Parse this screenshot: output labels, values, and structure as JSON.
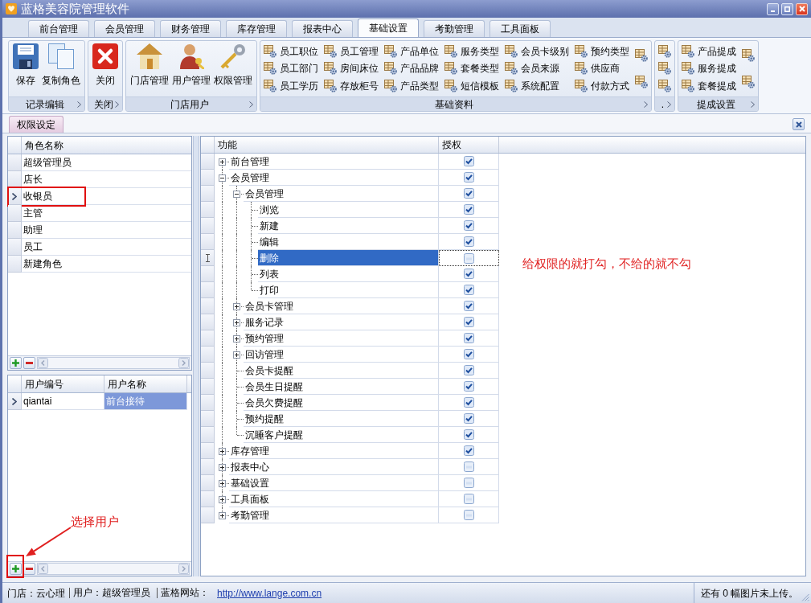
{
  "window": {
    "title": "蓝格美容院管理软件"
  },
  "menu_tabs": [
    {
      "label": "前台管理",
      "selected": false
    },
    {
      "label": "会员管理",
      "selected": false
    },
    {
      "label": "财务管理",
      "selected": false
    },
    {
      "label": "库存管理",
      "selected": false
    },
    {
      "label": "报表中心",
      "selected": false
    },
    {
      "label": "基础设置",
      "selected": true
    },
    {
      "label": "考勤管理",
      "selected": false
    },
    {
      "label": "工具面板",
      "selected": false
    }
  ],
  "ribbon": {
    "groups": [
      {
        "kind": "large",
        "label": "记录编辑",
        "buttons": [
          {
            "label": "保存"
          },
          {
            "label": "复制角色"
          }
        ]
      },
      {
        "kind": "large",
        "label": "关闭",
        "buttons": [
          {
            "label": "关闭"
          }
        ]
      },
      {
        "kind": "large",
        "label": "门店用户",
        "buttons": [
          {
            "label": "门店管理"
          },
          {
            "label": "用户管理"
          },
          {
            "label": "权限管理"
          }
        ]
      },
      {
        "kind": "small",
        "label": "基础资料",
        "columns": [
          [
            {
              "kind": "labeled",
              "label": "员工职位"
            },
            {
              "kind": "labeled",
              "label": "员工部门"
            },
            {
              "kind": "labeled",
              "label": "员工学历"
            }
          ],
          [
            {
              "kind": "labeled",
              "label": "员工管理"
            },
            {
              "kind": "labeled",
              "label": "房间床位"
            },
            {
              "kind": "labeled",
              "label": "存放柜号"
            }
          ],
          [
            {
              "kind": "labeled",
              "label": "产品单位"
            },
            {
              "kind": "labeled",
              "label": "产品品牌"
            },
            {
              "kind": "labeled",
              "label": "产品类型"
            }
          ],
          [
            {
              "kind": "labeled",
              "label": "服务类型"
            },
            {
              "kind": "labeled",
              "label": "套餐类型"
            },
            {
              "kind": "labeled",
              "label": "短信模板"
            }
          ],
          [
            {
              "kind": "labeled",
              "label": "会员卡级别"
            },
            {
              "kind": "labeled",
              "label": "会员来源"
            },
            {
              "kind": "labeled",
              "label": "系统配置"
            }
          ],
          [
            {
              "kind": "labeled",
              "label": "预约类型"
            },
            {
              "kind": "labeled",
              "label": "供应商"
            },
            {
              "kind": "labeled",
              "label": "付款方式"
            }
          ],
          [
            {
              "kind": "icon"
            },
            {
              "kind": "icon"
            }
          ]
        ]
      },
      {
        "kind": "small",
        "label": ".",
        "columns": [
          [
            {
              "kind": "icon"
            },
            {
              "kind": "icon"
            },
            {
              "kind": "icon"
            }
          ]
        ]
      },
      {
        "kind": "small",
        "label": "提成设置",
        "columns": [
          [
            {
              "kind": "labeled",
              "label": "产品提成"
            },
            {
              "kind": "labeled",
              "label": "服务提成"
            },
            {
              "kind": "labeled",
              "label": "套餐提成"
            }
          ],
          [
            {
              "kind": "icon"
            },
            {
              "kind": "icon"
            }
          ]
        ]
      }
    ]
  },
  "document_tab": {
    "label": "权限设定"
  },
  "roles_grid": {
    "columns": [
      "角色名称"
    ],
    "rows": [
      {
        "name": "超级管理员",
        "selected": false,
        "highlighted": false
      },
      {
        "name": "店长",
        "selected": false,
        "highlighted": false
      },
      {
        "name": "收银员",
        "selected": true,
        "highlighted": true
      },
      {
        "name": "主管",
        "selected": false,
        "highlighted": false
      },
      {
        "name": "助理",
        "selected": false,
        "highlighted": false
      },
      {
        "name": "员工",
        "selected": false,
        "highlighted": false
      },
      {
        "name": "新建角色",
        "selected": false,
        "highlighted": false
      }
    ]
  },
  "users_grid": {
    "columns": [
      "用户编号",
      "用户名称"
    ],
    "rows": [
      {
        "cells": [
          "qiantai",
          "前台接待"
        ],
        "selected": true
      }
    ],
    "add_highlighted": true
  },
  "permissions": {
    "columns": [
      "功能",
      "授权"
    ],
    "rows": [
      {
        "label": "前台管理",
        "expanded": false,
        "checked": true,
        "selected": false
      },
      {
        "label": "会员管理",
        "expanded": true,
        "checked": true,
        "selected": false,
        "children": [
          {
            "label": "会员管理",
            "expanded": true,
            "checked": true,
            "selected": false,
            "children": [
              {
                "label": "浏览",
                "checked": true,
                "selected": false
              },
              {
                "label": "新建",
                "checked": true,
                "selected": false
              },
              {
                "label": "编辑",
                "checked": true,
                "selected": false
              },
              {
                "label": "删除",
                "checked": false,
                "selected": true
              },
              {
                "label": "列表",
                "checked": true,
                "selected": false
              },
              {
                "label": "打印",
                "checked": true,
                "selected": false
              }
            ]
          },
          {
            "label": "会员卡管理",
            "expanded": false,
            "checked": true,
            "selected": false
          },
          {
            "label": "服务记录",
            "expanded": false,
            "checked": true,
            "selected": false
          },
          {
            "label": "预约管理",
            "expanded": false,
            "checked": true,
            "selected": false
          },
          {
            "label": "回访管理",
            "expanded": false,
            "checked": true,
            "selected": false
          },
          {
            "label": "会员卡提醒",
            "checked": true,
            "selected": false
          },
          {
            "label": "会员生日提醒",
            "checked": true,
            "selected": false
          },
          {
            "label": "会员欠费提醒",
            "checked": true,
            "selected": false
          },
          {
            "label": "预约提醒",
            "checked": true,
            "selected": false
          },
          {
            "label": "沉睡客户提醒",
            "checked": true,
            "selected": false
          }
        ]
      },
      {
        "label": "库存管理",
        "expanded": false,
        "checked": true,
        "selected": false
      },
      {
        "label": "报表中心",
        "expanded": false,
        "checked": false,
        "selected": false
      },
      {
        "label": "基础设置",
        "expanded": false,
        "checked": false,
        "selected": false
      },
      {
        "label": "工具面板",
        "expanded": false,
        "checked": false,
        "selected": false
      },
      {
        "label": "考勤管理",
        "expanded": false,
        "checked": false,
        "selected": false
      }
    ]
  },
  "annotations": [
    {
      "kind": "note",
      "text": "给权限的就打勾，不给的就不勾"
    },
    {
      "kind": "arrow_callout",
      "text": "选择用户"
    }
  ],
  "status_bar": {
    "store": "门店：云心理",
    "user": "用户：超级管理员",
    "website_label": "蓝格网站：",
    "website_link": "http://www.lange.com.cn",
    "upload_status": "还有 0 幅图片未上传。"
  }
}
